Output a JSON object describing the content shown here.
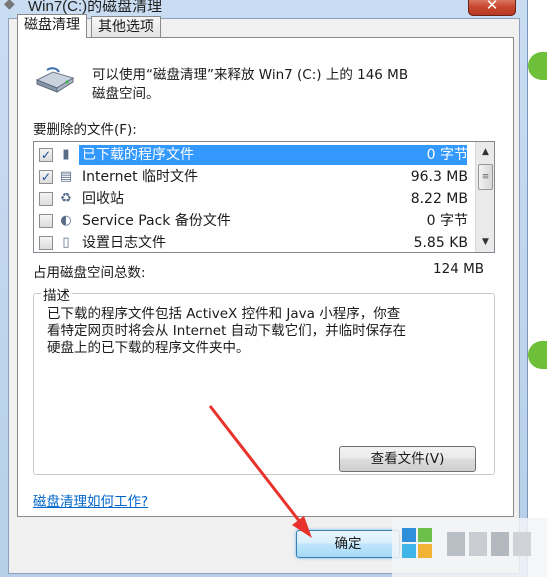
{
  "window": {
    "title": "Win7(C:)的磁盘清理",
    "close_glyph": "✕"
  },
  "tabs": [
    {
      "label": "磁盘清理",
      "active": true
    },
    {
      "label": "其他选项",
      "active": false
    }
  ],
  "summary": {
    "line1": "可以使用“磁盘清理”来释放 Win7 (C:) 上的 146 MB",
    "line2": "磁盘空间。"
  },
  "files_label": "要删除的文件(F):",
  "files": [
    {
      "checked": true,
      "icon": "download-folder-icon",
      "name": "已下载的程序文件",
      "size": "0 字节",
      "selected": true
    },
    {
      "checked": true,
      "icon": "internet-files-icon",
      "name": "Internet 临时文件",
      "size": "96.3 MB",
      "selected": false
    },
    {
      "checked": false,
      "icon": "recycle-bin-icon",
      "name": "回收站",
      "size": "8.22 MB",
      "selected": false
    },
    {
      "checked": false,
      "icon": "service-pack-icon",
      "name": "Service Pack 备份文件",
      "size": "0 字节",
      "selected": false
    },
    {
      "checked": false,
      "icon": "log-file-icon",
      "name": "设置日志文件",
      "size": "5.85 KB",
      "selected": false
    }
  ],
  "total": {
    "label": "占用磁盘空间总数:",
    "value": "124 MB"
  },
  "description": {
    "legend": "描述",
    "line1": "已下载的程序文件包括 ActiveX 控件和 Java 小程序，你查",
    "line2": "看特定网页时将会从 Internet 自动下载它们，并临时保存在",
    "line3": "硬盘上的已下载的程序文件夹中。",
    "view_button": "查看文件(V)"
  },
  "help_link": "磁盘清理如何工作?",
  "ok_button": "确定",
  "colors": {
    "selection": "#3399ff",
    "link": "#0066cc",
    "annotation_arrow": "#e8322b",
    "accent_green": "#6ebf3a"
  }
}
